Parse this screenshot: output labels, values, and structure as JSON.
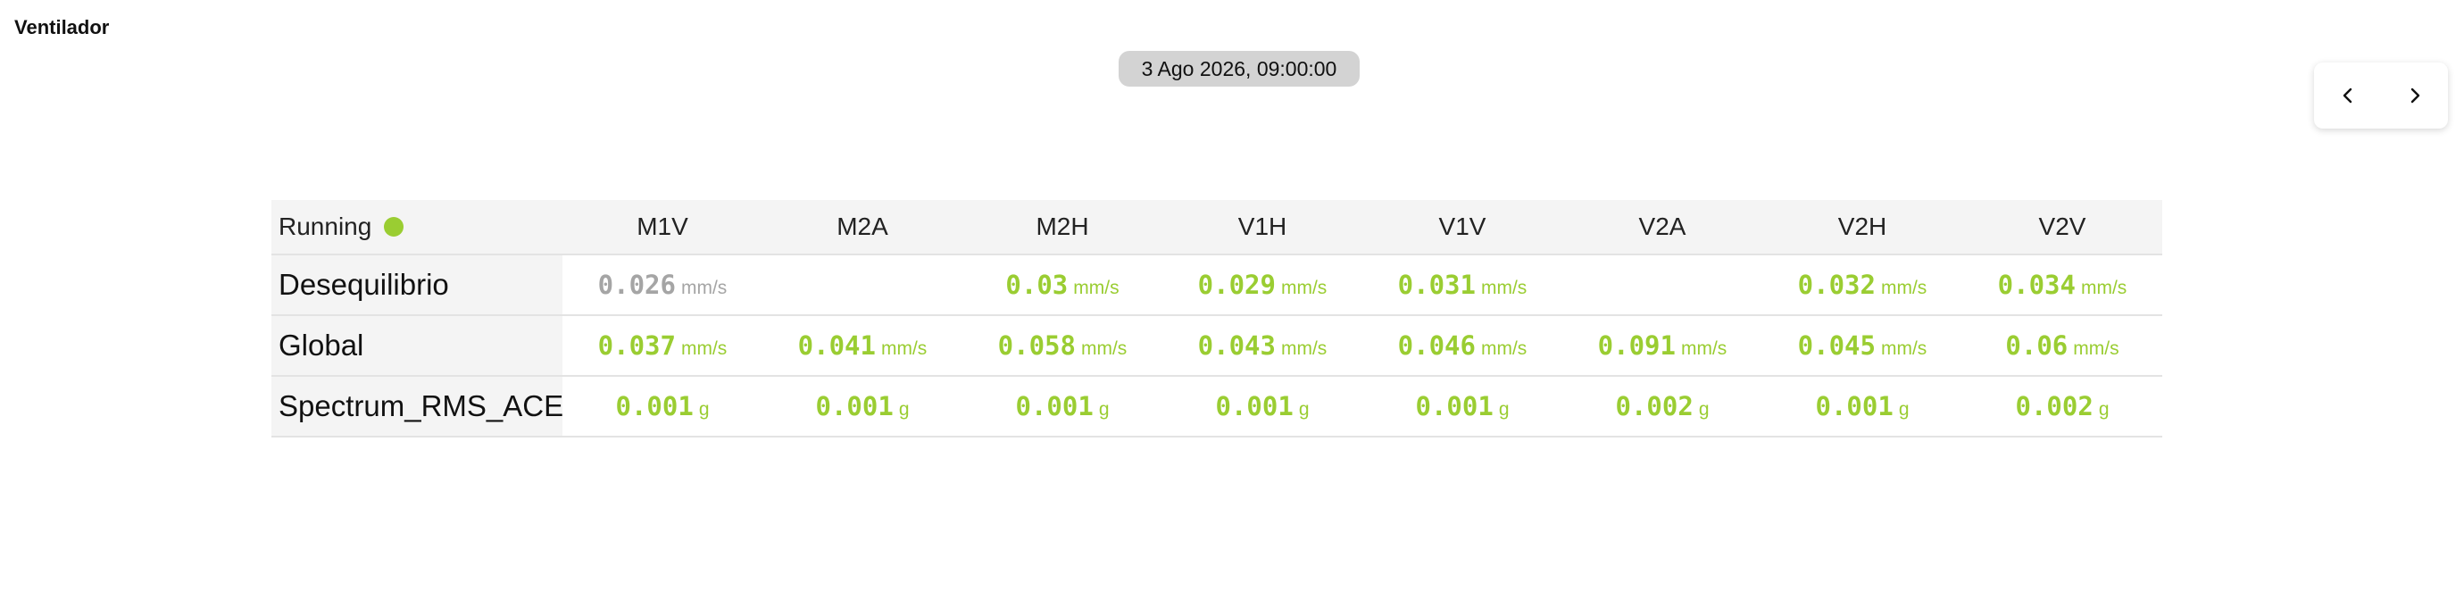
{
  "title": "Ventilador",
  "timestamp": "3 Ago 2026, 09:00:00",
  "navigation": {
    "prev_icon": "chevron-left-icon",
    "next_icon": "chevron-right-icon"
  },
  "status": {
    "label": "Running",
    "color": "#9acd32"
  },
  "colors": {
    "ok": "#9acd32",
    "stale": "#a5a5a5"
  },
  "columns": [
    "M1V",
    "M2A",
    "M2H",
    "V1H",
    "V1V",
    "V2A",
    "V2H",
    "V2V"
  ],
  "rows": [
    {
      "label": "Desequilibrio",
      "cells": [
        {
          "value": "0.026",
          "unit": "mm/s",
          "state": "stale"
        },
        {
          "value": "",
          "unit": "",
          "state": "empty"
        },
        {
          "value": "0.03",
          "unit": "mm/s",
          "state": "ok"
        },
        {
          "value": "0.029",
          "unit": "mm/s",
          "state": "ok"
        },
        {
          "value": "0.031",
          "unit": "mm/s",
          "state": "ok"
        },
        {
          "value": "",
          "unit": "",
          "state": "empty"
        },
        {
          "value": "0.032",
          "unit": "mm/s",
          "state": "ok"
        },
        {
          "value": "0.034",
          "unit": "mm/s",
          "state": "ok"
        }
      ]
    },
    {
      "label": "Global",
      "cells": [
        {
          "value": "0.037",
          "unit": "mm/s",
          "state": "ok"
        },
        {
          "value": "0.041",
          "unit": "mm/s",
          "state": "ok"
        },
        {
          "value": "0.058",
          "unit": "mm/s",
          "state": "ok"
        },
        {
          "value": "0.043",
          "unit": "mm/s",
          "state": "ok"
        },
        {
          "value": "0.046",
          "unit": "mm/s",
          "state": "ok"
        },
        {
          "value": "0.091",
          "unit": "mm/s",
          "state": "ok"
        },
        {
          "value": "0.045",
          "unit": "mm/s",
          "state": "ok"
        },
        {
          "value": "0.06",
          "unit": "mm/s",
          "state": "ok"
        }
      ]
    },
    {
      "label": "Spectrum_RMS_ACE",
      "cells": [
        {
          "value": "0.001",
          "unit": "g",
          "state": "ok"
        },
        {
          "value": "0.001",
          "unit": "g",
          "state": "ok"
        },
        {
          "value": "0.001",
          "unit": "g",
          "state": "ok"
        },
        {
          "value": "0.001",
          "unit": "g",
          "state": "ok"
        },
        {
          "value": "0.001",
          "unit": "g",
          "state": "ok"
        },
        {
          "value": "0.002",
          "unit": "g",
          "state": "ok"
        },
        {
          "value": "0.001",
          "unit": "g",
          "state": "ok"
        },
        {
          "value": "0.002",
          "unit": "g",
          "state": "ok"
        }
      ]
    }
  ]
}
